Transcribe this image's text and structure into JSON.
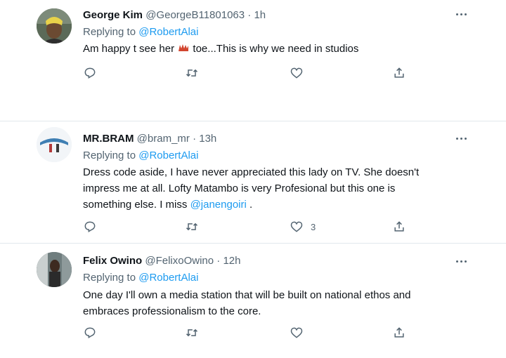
{
  "tweets": [
    {
      "name": "George Kim",
      "handle": "@GeorgeB11801063",
      "sep": "·",
      "time": "1h",
      "replying_prefix": "Replying to",
      "replying_to": "@RobertAlai",
      "text_before_emoji": "Am happy t see her",
      "text_after_emoji": "toe...This is why we need in studios",
      "like_count": ""
    },
    {
      "name": "MR.BRAM",
      "handle": "@bram_mr",
      "sep": "·",
      "time": "13h",
      "replying_prefix": "Replying to",
      "replying_to": "@RobertAlai",
      "text_line1": "Dress code aside, I have never appreciated this lady on TV. She doesn't",
      "text_line2": "impress me at all. Lofty Matambo is very Profesional but this one is",
      "text_line3_prefix": "something else. I miss",
      "text_line3_mention": "@janengoiri",
      "text_line3_suffix": ".",
      "like_count": "3"
    },
    {
      "name": "Felix Owino",
      "handle": "@FelixoOwino",
      "sep": "·",
      "time": "12h",
      "replying_prefix": "Replying to",
      "replying_to": "@RobertAlai",
      "text_line1": "One day I'll own a media station that will be built on national ethos and",
      "text_line2": "embraces professionalism to the core.",
      "like_count": ""
    }
  ],
  "icons": {
    "reply": "reply-icon",
    "retweet": "retweet-icon",
    "like": "heart-icon",
    "share": "share-icon",
    "more": "more-options-icon",
    "emoji": "emoji-icon"
  },
  "colors": {
    "link": "#1d9bf0",
    "secondary_text": "#536471",
    "primary_text": "#0f1419",
    "divider": "#e1e8ed"
  }
}
